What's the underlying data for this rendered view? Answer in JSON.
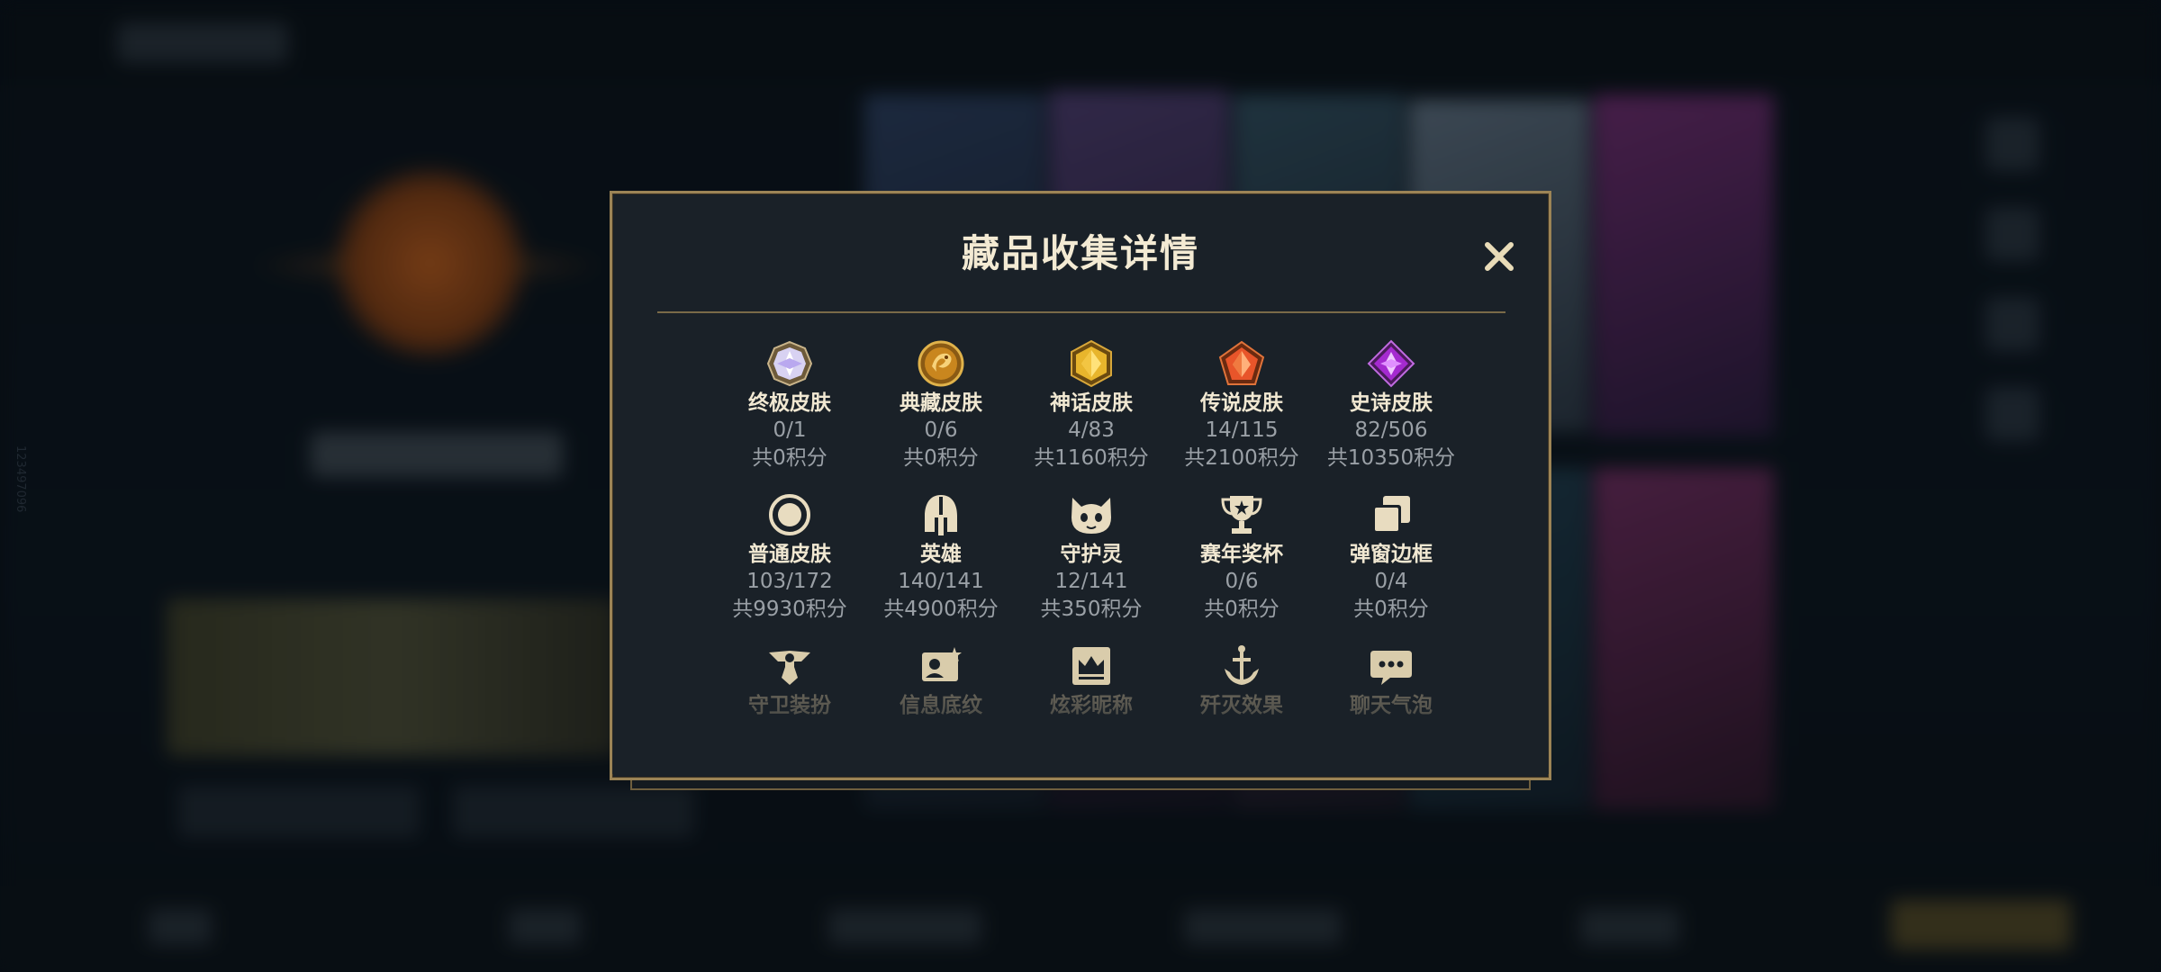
{
  "side_id": "123497096",
  "modal": {
    "title": "藏品收集详情",
    "close_icon": "close-icon"
  },
  "rows": [
    [
      {
        "key": "ultimate",
        "name": "终极皮肤",
        "count": "0/1",
        "points": "共0积分",
        "icon": "ultimate-gem-icon"
      },
      {
        "key": "classic",
        "name": "典藏皮肤",
        "count": "0/6",
        "points": "共0积分",
        "icon": "dragon-coin-icon"
      },
      {
        "key": "mythic",
        "name": "神话皮肤",
        "count": "4/83",
        "points": "共1160积分",
        "icon": "gold-gem-icon"
      },
      {
        "key": "legendary",
        "name": "传说皮肤",
        "count": "14/115",
        "points": "共2100积分",
        "icon": "orange-gem-icon"
      },
      {
        "key": "epic",
        "name": "史诗皮肤",
        "count": "82/506",
        "points": "共10350积分",
        "icon": "purple-gem-icon"
      }
    ],
    [
      {
        "key": "normal",
        "name": "普通皮肤",
        "count": "103/172",
        "points": "共9930积分",
        "icon": "ring-icon"
      },
      {
        "key": "hero",
        "name": "英雄",
        "count": "140/141",
        "points": "共4900积分",
        "icon": "helmet-icon"
      },
      {
        "key": "guardian",
        "name": "守护灵",
        "count": "12/141",
        "points": "共350积分",
        "icon": "guardian-pet-icon"
      },
      {
        "key": "trophy",
        "name": "赛年奖杯",
        "count": "0/6",
        "points": "共0积分",
        "icon": "trophy-icon"
      },
      {
        "key": "frame",
        "name": "弹窗边框",
        "count": "0/4",
        "points": "共0积分",
        "icon": "stacked-frames-icon"
      }
    ],
    [
      {
        "key": "guard_outfit",
        "name": "守卫装扮",
        "icon": "winged-guard-icon"
      },
      {
        "key": "info_bg",
        "name": "信息底纹",
        "icon": "profile-card-icon"
      },
      {
        "key": "nickname",
        "name": "炫彩昵称",
        "icon": "crown-card-icon"
      },
      {
        "key": "kill_effect",
        "name": "歼灭效果",
        "icon": "anchor-icon"
      },
      {
        "key": "chat_bubble",
        "name": "聊天气泡",
        "icon": "chat-bubble-icon"
      }
    ]
  ],
  "colors": {
    "gold_border": "#9c8456",
    "title_text": "#f3ead3",
    "muted_text": "#9aa0a6",
    "panel_bg": "#1a2128"
  }
}
